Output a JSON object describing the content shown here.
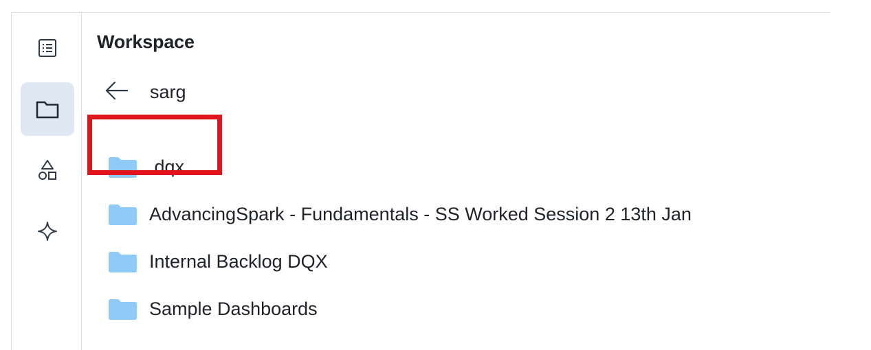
{
  "sidebar": {
    "items": [
      {
        "name": "list-icon",
        "active": false
      },
      {
        "name": "folder-icon",
        "active": true
      },
      {
        "name": "shapes-icon",
        "active": false
      },
      {
        "name": "sparkle-icon",
        "active": false
      }
    ]
  },
  "panel": {
    "title": "Workspace",
    "back_icon": "arrow-left-icon",
    "breadcrumb": "sarg",
    "folders": [
      {
        "label": ".dqx",
        "icon": "folder-icon",
        "highlighted": true
      },
      {
        "label": "AdvancingSpark - Fundamentals - SS Worked Session 2 13th Jan",
        "icon": "folder-icon",
        "highlighted": false
      },
      {
        "label": "Internal Backlog DQX",
        "icon": "folder-icon",
        "highlighted": false
      },
      {
        "label": "Sample Dashboards",
        "icon": "folder-icon",
        "highlighted": false
      }
    ]
  },
  "colors": {
    "folder": "#90caf9",
    "highlight": "#e0141b",
    "active_rail": "#dfe8f2",
    "icon_stroke": "#2d3a45"
  }
}
